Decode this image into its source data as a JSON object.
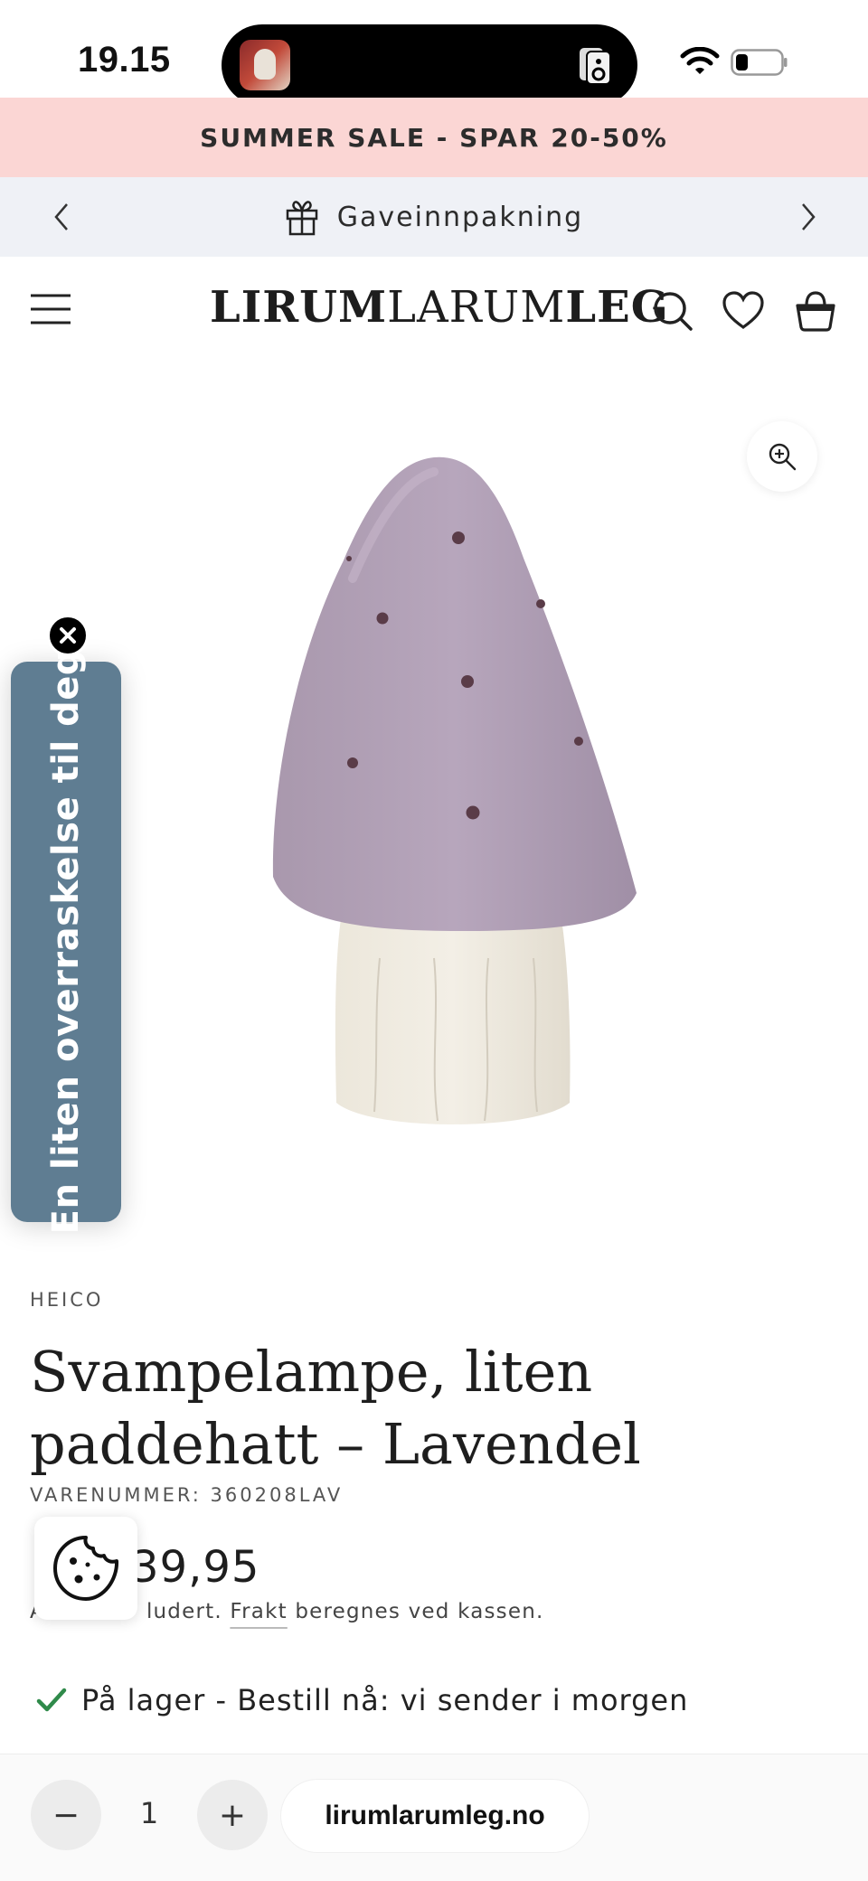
{
  "status_bar": {
    "time": "19.15",
    "icons": [
      "app-avatar-icon",
      "speaker-icon",
      "wifi-icon",
      "battery-icon"
    ]
  },
  "promo_banner": {
    "text": "SUMMER SALE - SPAR 20-50%",
    "background": "#fbd6d4"
  },
  "announcement": {
    "text": "Gaveinnpakning",
    "icon": "gift-icon",
    "background": "#eff1f6"
  },
  "header": {
    "logo_strong": "LIRUM",
    "logo_light": "LARUM",
    "logo_strong_2": "LEG",
    "icons": [
      "menu-icon",
      "search-icon",
      "heart-icon",
      "cart-icon"
    ]
  },
  "side_tab": {
    "text": "En liten overraskelse til deg",
    "color": "#5f7d92"
  },
  "product": {
    "vendor": "HEICO",
    "title": "Svampelampe, liten paddehatt – Lavendel",
    "sku": "VARENUMMER: 360208LAV",
    "price_visible": "39,95",
    "tax_prefix": "A",
    "tax_middle": "ludert.",
    "shipping_link": "Frakt",
    "shipping_rest": "beregnes ved kassen.",
    "stock": "På lager - Bestill nå: vi sender i morgen",
    "stock_color": "#2f8a4a"
  },
  "bottom_bar": {
    "minus": "−",
    "quantity": "1",
    "plus": "+",
    "url": "lirumlarumleg.no"
  }
}
